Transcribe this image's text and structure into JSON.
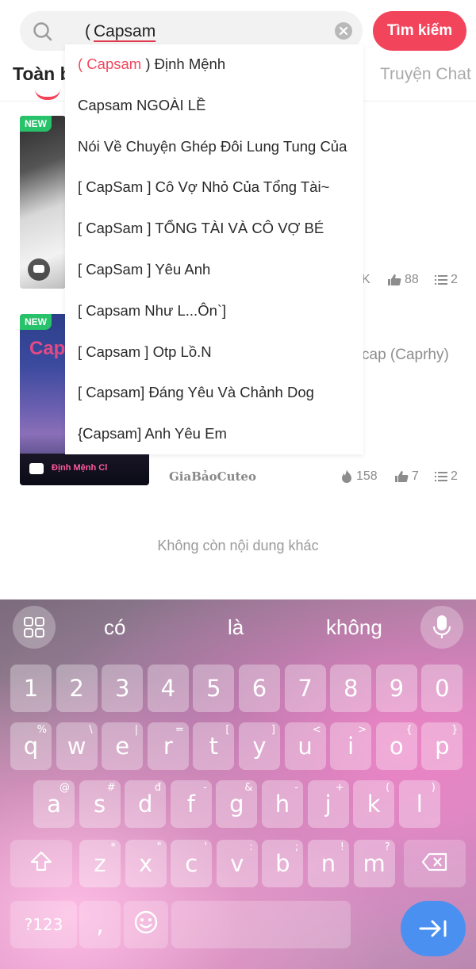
{
  "search": {
    "paren": "(",
    "query": "Capsam",
    "button_label": "Tìm kiếm"
  },
  "tabs": {
    "all_label_partial": "Toàn b",
    "chat_label": "Truyện Chat"
  },
  "suggestions": [
    {
      "highlight": "( Capsam",
      "rest": " ) Định Mệnh"
    },
    {
      "highlight": "",
      "rest": "Capsam NGOÀI LỀ"
    },
    {
      "highlight": "",
      "rest": "Nói Về Chuyện Ghép Đôi Lung Tung Của"
    },
    {
      "highlight": "",
      "rest": "[ CapSam ] Cô Vợ Nhỏ Của Tổng Tài~"
    },
    {
      "highlight": "",
      "rest": "[ CapSam ] TỔNG TÀI VÀ CÔ VỢ BÉ"
    },
    {
      "highlight": "",
      "rest": "[ CapSam ] Yêu Anh"
    },
    {
      "highlight": "",
      "rest": "[ Capsam Như L...Ôn`]"
    },
    {
      "highlight": "",
      "rest": "[ Capsam ] Otp Lồ.N"
    },
    {
      "highlight": "",
      "rest": "[ Capsam] Đáng Yêu Và Chảnh Dog"
    },
    {
      "highlight": "",
      "rest": "{Capsam] Anh Yêu Em"
    }
  ],
  "results": [
    {
      "badge": "NEW",
      "stat_k": "K",
      "likes": "88",
      "chapters": "2"
    },
    {
      "badge": "NEW",
      "thumb_title": "Caps",
      "thumb_caption": "Định Mệnh Cl",
      "author_tail": "cap (Caprhy)",
      "author": "GiaBảoCuteo",
      "views": "158",
      "likes": "7",
      "chapters": "2"
    }
  ],
  "end_text": "Không còn nội dung khác",
  "keyboard": {
    "suggestions": [
      "có",
      "là",
      "không"
    ],
    "row_numbers": [
      "1",
      "2",
      "3",
      "4",
      "5",
      "6",
      "7",
      "8",
      "9",
      "0"
    ],
    "row1": [
      {
        "k": "q",
        "s": "%"
      },
      {
        "k": "w",
        "s": "\\"
      },
      {
        "k": "e",
        "s": "|"
      },
      {
        "k": "r",
        "s": "="
      },
      {
        "k": "t",
        "s": "["
      },
      {
        "k": "y",
        "s": "]"
      },
      {
        "k": "u",
        "s": "<"
      },
      {
        "k": "i",
        "s": ">"
      },
      {
        "k": "o",
        "s": "{"
      },
      {
        "k": "p",
        "s": "}"
      }
    ],
    "row2": [
      {
        "k": "a",
        "s": "@"
      },
      {
        "k": "s",
        "s": "#"
      },
      {
        "k": "d",
        "s": "đ"
      },
      {
        "k": "f",
        "s": "-"
      },
      {
        "k": "g",
        "s": "&"
      },
      {
        "k": "h",
        "s": "-"
      },
      {
        "k": "j",
        "s": "+"
      },
      {
        "k": "k",
        "s": "("
      },
      {
        "k": "l",
        "s": ")"
      }
    ],
    "row3": [
      {
        "k": "z",
        "s": "*"
      },
      {
        "k": "x",
        "s": "\""
      },
      {
        "k": "c",
        "s": "'"
      },
      {
        "k": "v",
        "s": ":"
      },
      {
        "k": "b",
        "s": ";"
      },
      {
        "k": "n",
        "s": "!"
      },
      {
        "k": "m",
        "s": "?"
      }
    ],
    "mode_label": "?123",
    "comma": ","
  },
  "colors": {
    "accent": "#f2455c",
    "new_badge": "#27c26a",
    "enter_key": "#4a90f0"
  }
}
